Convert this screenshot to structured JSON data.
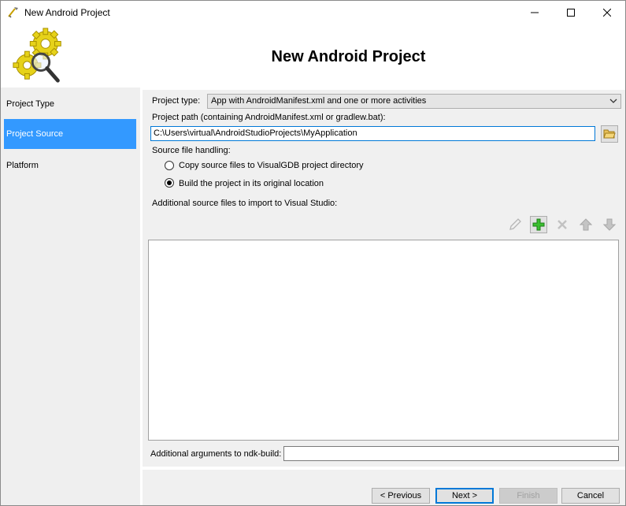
{
  "window": {
    "title": "New Android Project",
    "controls": [
      "minimize",
      "maximize",
      "close"
    ]
  },
  "header": {
    "title": "New Android Project",
    "logo_icon": "gears-magnifier-icon"
  },
  "sidebar": {
    "items": [
      {
        "label": "Project Type",
        "selected": false
      },
      {
        "label": "Project Source",
        "selected": true
      },
      {
        "label": "Platform",
        "selected": false
      }
    ],
    "selected_color": "#3399ff"
  },
  "main": {
    "project_type_label": "Project type:",
    "project_type_value": "App with AndroidManifest.xml and one or more activities",
    "project_path_label": "Project path (containing AndroidManifest.xml or gradlew.bat):",
    "project_path_value": "C:\\Users\\virtual\\AndroidStudioProjects\\MyApplication",
    "source_handling_label": "Source file handling:",
    "radio_copy_label": "Copy source files to VisualGDB project directory",
    "radio_build_label": "Build the project in its original location",
    "radio_selected": "build",
    "additional_files_label": "Additional source files to import to Visual Studio:",
    "toolbar_icons": [
      "pencil-icon",
      "add-icon",
      "delete-icon",
      "move-up-icon",
      "move-down-icon"
    ],
    "ndk_args_label": "Additional arguments to ndk-build:",
    "ndk_args_value": ""
  },
  "footer": {
    "previous_label": "< Previous",
    "next_label": "Next >",
    "finish_label": "Finish",
    "cancel_label": "Cancel"
  }
}
